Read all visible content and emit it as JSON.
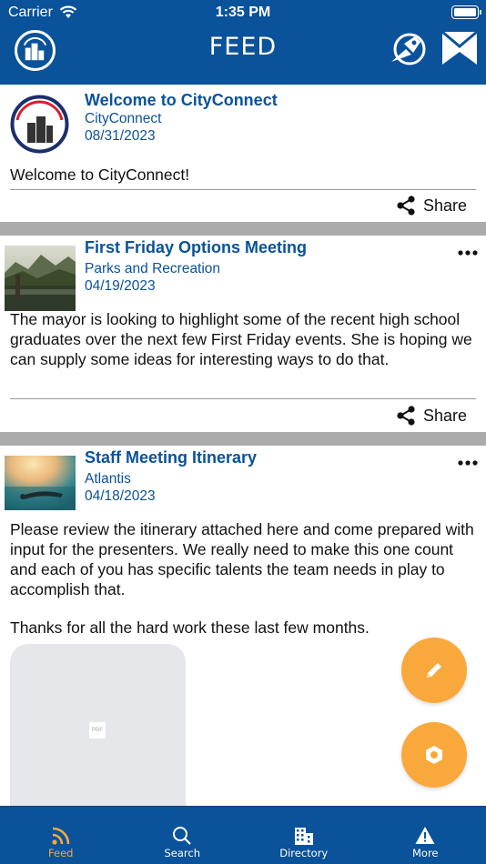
{
  "status_bar": {
    "carrier": "Carrier",
    "time": "1:35 PM"
  },
  "header": {
    "title": "FEED",
    "left_icon": "cityconnect-logo-icon",
    "right_icons": [
      "rocket-icon",
      "inbox-icon"
    ]
  },
  "posts": [
    {
      "title": "Welcome to CityConnect",
      "source": "CityConnect",
      "date": "08/31/2023",
      "body": "Welcome to CityConnect!",
      "share_label": "Share",
      "thumbnail": "cityconnect-logo"
    },
    {
      "title": "First Friday Options Meeting",
      "source": "Parks and Recreation",
      "date": "04/19/2023",
      "body": "The mayor is looking to highlight some of the recent high school graduates over the next few First Friday events. She is hoping we can supply some ideas for interesting ways to do that.",
      "share_label": "Share",
      "thumbnail": "mountain-lake-photo"
    },
    {
      "title": "Staff Meeting Itinerary",
      "source": "Atlantis",
      "date": "04/18/2023",
      "body_lines": [
        "Please review the itinerary attached here and come prepared with input for the presenters. We really need to make this one count and each of you has specific talents the team needs in play to accomplish that.",
        "Thanks for all the hard work these last few months."
      ],
      "attachment_label": "PDF",
      "thumbnail": "underwater-swimmer-photo"
    }
  ],
  "fabs": [
    "edit-icon",
    "settings-hex-icon"
  ],
  "tabs": [
    {
      "label": "Feed",
      "icon": "rss-icon",
      "active": true
    },
    {
      "label": "Search",
      "icon": "search-icon",
      "active": false
    },
    {
      "label": "Directory",
      "icon": "building-icon",
      "active": false
    },
    {
      "label": "More",
      "icon": "warning-icon",
      "active": false
    }
  ],
  "colors": {
    "brand_blue": "#0a5299",
    "accent_orange": "#f9a93b",
    "separator_gray": "#ababab"
  }
}
